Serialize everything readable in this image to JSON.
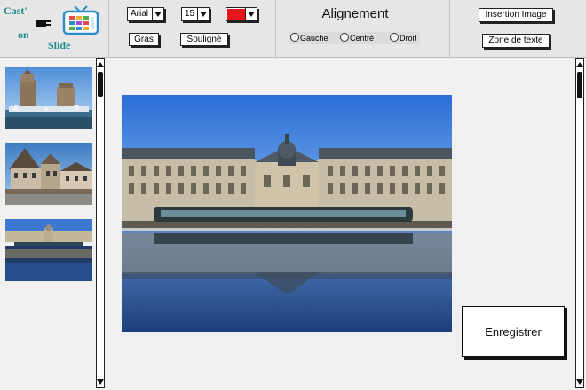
{
  "logo": {
    "line1": "Cast'",
    "line2": "on",
    "line3": "Slide"
  },
  "toolbar": {
    "font": "Arial",
    "size": "15",
    "color": "#e8161b",
    "bold_label": "Gras",
    "underline_label": "Souligné",
    "alignment": {
      "title": "Alignement",
      "options": [
        "Gauche",
        "Centré",
        "Droit"
      ]
    },
    "insert_image_label": "Insertion Image",
    "textbox_label": "Zone de texte"
  },
  "slides": [
    {
      "name": "slide-thumb-1"
    },
    {
      "name": "slide-thumb-2"
    },
    {
      "name": "slide-thumb-3"
    }
  ],
  "save_label": "Enregistrer"
}
